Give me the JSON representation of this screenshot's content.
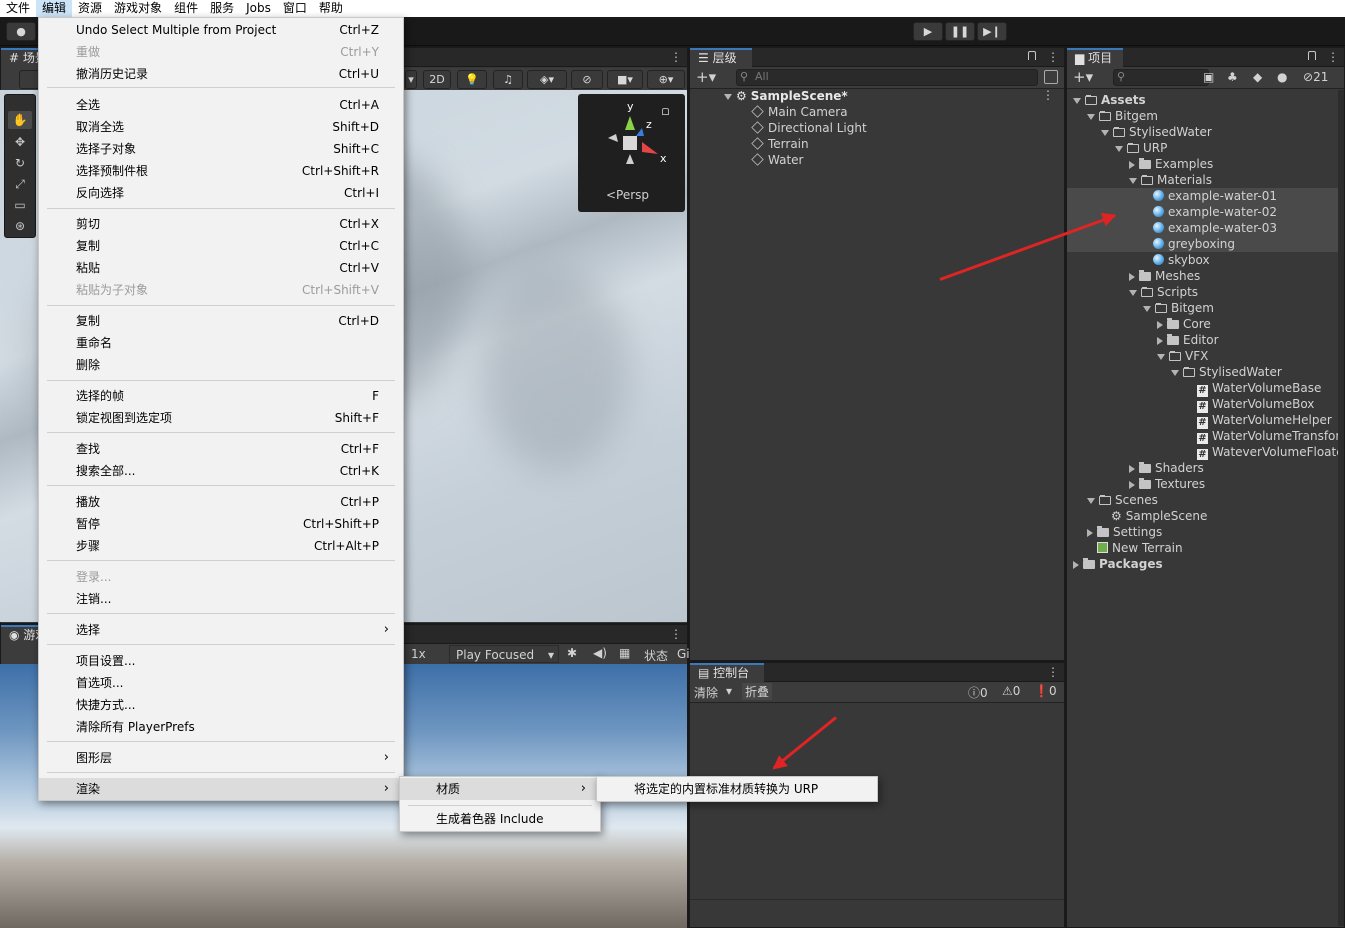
{
  "menubar": {
    "items": [
      "文件",
      "编辑",
      "资源",
      "游戏对象",
      "组件",
      "服务",
      "Jobs",
      "窗口",
      "帮助"
    ]
  },
  "scene_tab": {
    "label": "场景"
  },
  "game_tab": {
    "label": "游戏"
  },
  "scene_toolbar": {
    "mode_2d": "2D"
  },
  "gizmo": {
    "persp_label": "<Persp",
    "axis_y": "y",
    "axis_x": "x",
    "axis_z": "z"
  },
  "game_toolbar": {
    "scale": "1x",
    "play_mode": "Play Focused",
    "stats": "状态",
    "gizmos": "Gi"
  },
  "hierarchy": {
    "tab": "层级",
    "search_placeholder": "All",
    "scene": "SampleScene*",
    "items": [
      "Main Camera",
      "Directional Light",
      "Terrain",
      "Water"
    ]
  },
  "project": {
    "tab": "项目",
    "hidden_count": "21",
    "tree": {
      "assets": "Assets",
      "bitgem": "Bitgem",
      "stylised_water": "StylisedWater",
      "urp": "URP",
      "examples": "Examples",
      "materials": "Materials",
      "mat1": "example-water-01",
      "mat2": "example-water-02",
      "mat3": "example-water-03",
      "mat4": "greyboxing",
      "mat5": "skybox",
      "meshes": "Meshes",
      "scripts": "Scripts",
      "bitgem2": "Bitgem",
      "core": "Core",
      "editor": "Editor",
      "vfx": "VFX",
      "stylised_water2": "StylisedWater",
      "cs1": "WaterVolumeBase",
      "cs2": "WaterVolumeBox",
      "cs3": "WaterVolumeHelper",
      "cs4": "WaterVolumeTransfor",
      "cs5": "WateverVolumeFloate",
      "shaders": "Shaders",
      "textures": "Textures",
      "scenes": "Scenes",
      "sample_scene": "SampleScene",
      "settings": "Settings",
      "new_terrain": "New Terrain",
      "packages": "Packages"
    }
  },
  "console": {
    "tab": "控制台",
    "clear": "清除",
    "collapse": "折叠",
    "counts": [
      "0",
      "0",
      "0"
    ]
  },
  "edit_menu": {
    "items": [
      {
        "label": "Undo Select Multiple from Project",
        "key": "Ctrl+Z"
      },
      {
        "label": "重做",
        "key": "Ctrl+Y",
        "disabled": true
      },
      {
        "label": "撤消历史记录",
        "key": "Ctrl+U"
      },
      {
        "label": "全选",
        "key": "Ctrl+A"
      },
      {
        "label": "取消全选",
        "key": "Shift+D"
      },
      {
        "label": "选择子对象",
        "key": "Shift+C"
      },
      {
        "label": "选择预制件根",
        "key": "Ctrl+Shift+R"
      },
      {
        "label": "反向选择",
        "key": "Ctrl+I"
      },
      {
        "label": "剪切",
        "key": "Ctrl+X"
      },
      {
        "label": "复制",
        "key": "Ctrl+C"
      },
      {
        "label": "粘贴",
        "key": "Ctrl+V"
      },
      {
        "label": "粘贴为子对象",
        "key": "Ctrl+Shift+V",
        "disabled": true
      },
      {
        "label": "复制",
        "key": "Ctrl+D"
      },
      {
        "label": "重命名",
        "key": ""
      },
      {
        "label": "删除",
        "key": ""
      },
      {
        "label": "选择的帧",
        "key": "F"
      },
      {
        "label": "锁定视图到选定项",
        "key": "Shift+F"
      },
      {
        "label": "查找",
        "key": "Ctrl+F"
      },
      {
        "label": "搜索全部...",
        "key": "Ctrl+K"
      },
      {
        "label": "播放",
        "key": "Ctrl+P"
      },
      {
        "label": "暂停",
        "key": "Ctrl+Shift+P"
      },
      {
        "label": "步骤",
        "key": "Ctrl+Alt+P"
      },
      {
        "label": "登录...",
        "key": "",
        "disabled": true
      },
      {
        "label": "注销...",
        "key": ""
      },
      {
        "label": "选择",
        "key": ""
      },
      {
        "label": "项目设置...",
        "key": ""
      },
      {
        "label": "首选项...",
        "key": ""
      },
      {
        "label": "快捷方式...",
        "key": ""
      },
      {
        "label": "清除所有 PlayerPrefs",
        "key": ""
      },
      {
        "label": "图形层",
        "key": ""
      },
      {
        "label": "渲染",
        "key": ""
      }
    ]
  },
  "render_submenu": {
    "items": [
      "材质",
      "生成着色器 Include"
    ]
  },
  "material_submenu": {
    "items": [
      "将选定的内置标准材质转换为 URP"
    ]
  }
}
